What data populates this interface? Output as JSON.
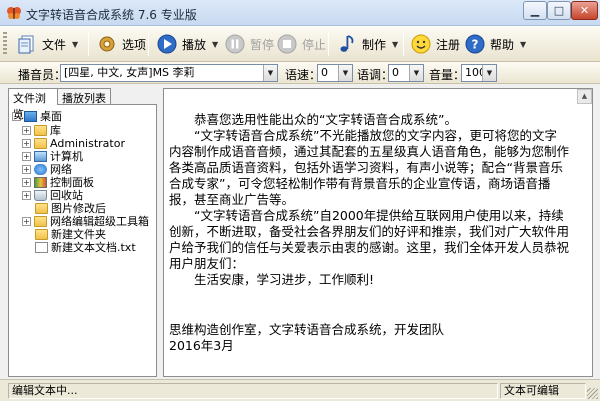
{
  "window": {
    "title": "文字转语音合成系统 7.6 专业版",
    "minimize_glyph": "▁",
    "maximize_glyph": "□",
    "close_glyph": "✕"
  },
  "toolbar": {
    "file_label": "文件",
    "options_label": "选项",
    "play_label": "播放",
    "pause_label": "暂停",
    "stop_label": "停止",
    "produce_label": "制作",
    "register_label": "注册",
    "help_label": "帮助"
  },
  "settings": {
    "speaker_label": "播音员：",
    "speaker_value": "[四星, 中文, 女声]MS 李莉",
    "speed_label": "语速：",
    "speed_value": "0",
    "pitch_label": "语调：",
    "pitch_value": "0",
    "volume_label": "音量：",
    "volume_value": "100"
  },
  "left_panel": {
    "tabs": [
      {
        "label": "文件浏览",
        "active": true
      },
      {
        "label": "播放列表",
        "active": false
      }
    ],
    "tree": [
      {
        "label": "桌面",
        "expander": "−",
        "icon": "desktop-icon"
      },
      {
        "label": "库",
        "expander": "+",
        "icon": "library-icon"
      },
      {
        "label": "Administrator",
        "expander": "+",
        "icon": "user-icon"
      },
      {
        "label": "计算机",
        "expander": "+",
        "icon": "computer-icon"
      },
      {
        "label": "网络",
        "expander": "+",
        "icon": "network-icon"
      },
      {
        "label": "控制面板",
        "expander": "+",
        "icon": "control-panel-icon"
      },
      {
        "label": "回收站",
        "expander": "+",
        "icon": "recycle-bin-icon"
      },
      {
        "label": "图片修改后",
        "expander": "",
        "icon": "folder-icon"
      },
      {
        "label": "网络编辑超级工具箱",
        "expander": "+",
        "icon": "folder-icon"
      },
      {
        "label": "新建文件夹",
        "expander": "",
        "icon": "folder-icon"
      },
      {
        "label": "新建文本文档.txt",
        "expander": "",
        "icon": "text-file-icon"
      }
    ]
  },
  "editor": {
    "lines": [
      "恭喜您选用性能出众的“文字转语音合成系统”。",
      "“文字转语音合成系统”不光能播放您的文字内容，更可将您的文字",
      "内容制作成语音音频，通过其配套的五星级真人语音角色，能够为您制作",
      "各类高品质语音资料，包括外语学习资料，有声小说等；配合“背景音乐",
      "合成专家”，可令您轻松制作带有背景音乐的企业宣传语，商场语音播",
      "报，甚至商业广告等。",
      "“文字转语音合成系统”自2000年提供给互联网用户使用以来，持续",
      "创新，不断进取，备受社会各界朋友们的好评和推崇，我们对广大软件用",
      "户给予我们的信任与关爱表示由衷的感谢。这里，我们全体开发人员恭祝",
      "用户朋友们：",
      "生活安康，学习进步，工作顺利!",
      "思维构造创作室，文字转语音合成系统，开发团队",
      "2016年3月"
    ]
  },
  "statusbar": {
    "left_text": "编辑文本中...",
    "right_text": "文本可编辑"
  }
}
